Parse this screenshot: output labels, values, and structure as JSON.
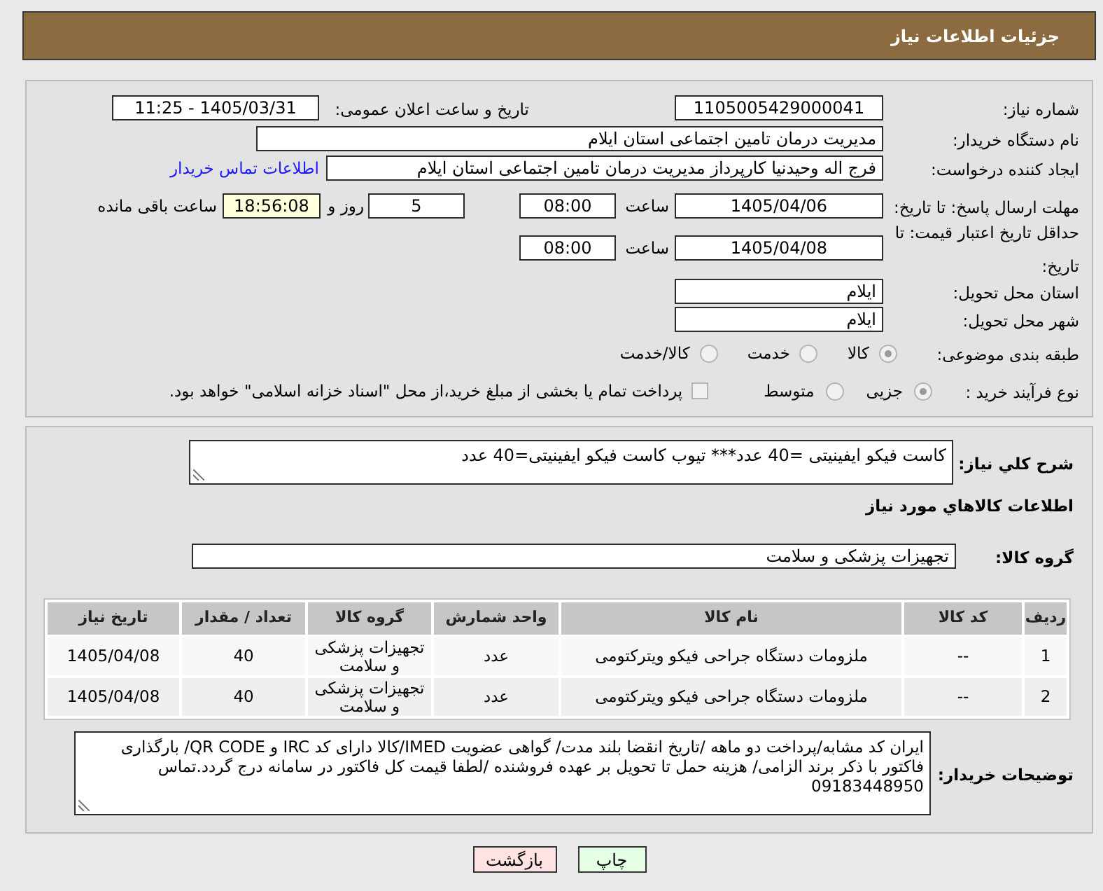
{
  "header": {
    "title": "جزئیات اطلاعات نیاز"
  },
  "details": {
    "need_number": {
      "label": "شماره نیاز:",
      "value": "1105005429000041"
    },
    "announcement": {
      "label": "تاریخ و ساعت اعلان عمومی:",
      "value": "1405/03/31 - 11:25"
    },
    "buyer_org": {
      "label": "نام دستگاه خریدار:",
      "value": "مدیریت درمان تامین اجتماعی استان ایلام"
    },
    "requester": {
      "label": "ایجاد کننده درخواست:",
      "value": "فرج اله وحیدنیا کارپرداز مدیریت درمان تامین اجتماعی استان ایلام",
      "contact_link": "اطلاعات تماس خریدار"
    },
    "response_deadline": {
      "label": "مهلت ارسال پاسخ: تا تاریخ:",
      "date": "1405/04/06",
      "time_label": "ساعت",
      "time": "08:00",
      "days": "5",
      "days_label": "روز و",
      "remaining": "18:56:08",
      "remaining_label": "ساعت باقی مانده"
    },
    "price_validity": {
      "label": "حداقل تاریخ اعتبار قیمت: تا تاریخ:",
      "date": "1405/04/08",
      "time_label": "ساعت",
      "time": "08:00"
    },
    "delivery_province": {
      "label": "استان محل تحویل:",
      "value": "ایلام"
    },
    "delivery_city": {
      "label": "شهر محل تحویل:",
      "value": "ایلام"
    },
    "category": {
      "label": "طبقه بندی موضوعی:",
      "options": [
        {
          "label": "کالا",
          "selected": true,
          "disabled": true
        },
        {
          "label": "خدمت",
          "selected": false,
          "disabled": true
        },
        {
          "label": "کالا/خدمت",
          "selected": false,
          "disabled": true
        }
      ]
    },
    "purchase_process": {
      "label": "نوع فرآیند خرید :",
      "options": [
        {
          "label": "جزیی",
          "selected": true,
          "disabled": true
        },
        {
          "label": "متوسط",
          "selected": false,
          "disabled": true
        }
      ],
      "treasury_payment": {
        "label": "پرداخت تمام یا بخشی از مبلغ خرید،از محل \"اسناد خزانه اسلامی\" خواهد بود.",
        "checked": false,
        "disabled": true
      }
    }
  },
  "description": {
    "label": "شرح کلي نياز:",
    "value": "کاست فیکو ایفینیتی =40 عدد*** تیوب کاست فیکو ایفینیتی=40 عدد"
  },
  "goods": {
    "title": "اطلاعات کالاهاي مورد نياز",
    "group_label": "گروه کالا:",
    "group_value": "تجهیزات پزشکی و سلامت"
  },
  "table": {
    "columns": [
      "ردیف",
      "کد کالا",
      "نام کالا",
      "واحد شمارش",
      "گروه کالا",
      "تعداد / مقدار",
      "تاریخ نیاز"
    ],
    "rows": [
      [
        "1",
        "--",
        "ملزومات دستگاه جراحی فیکو ویترکتومی",
        "عدد",
        "تجهیزات پزشکی و سلامت",
        "40",
        "1405/04/08"
      ],
      [
        "2",
        "--",
        "ملزومات دستگاه جراحی فیکو ویترکتومی",
        "عدد",
        "تجهیزات پزشکی و سلامت",
        "40",
        "1405/04/08"
      ]
    ]
  },
  "buyer_notes": {
    "label": "توضیحات خریدار:",
    "value": "ایران کد مشابه/پرداخت دو ماهه /تاریخ انقضا بلند مدت/ گواهی عضویت IMED/کالا دارای کد IRC  و QR CODE/ بارگذاری فاکتور با ذکر برند الزامی/ هزینه حمل تا تحویل بر عهده فروشنده /لطفا قیمت کل فاکتور در سامانه درج گردد.تماس 09183448950"
  },
  "buttons": [
    {
      "label": "چاپ",
      "kind": "print"
    },
    {
      "label": "بازگشت",
      "kind": "back"
    }
  ]
}
